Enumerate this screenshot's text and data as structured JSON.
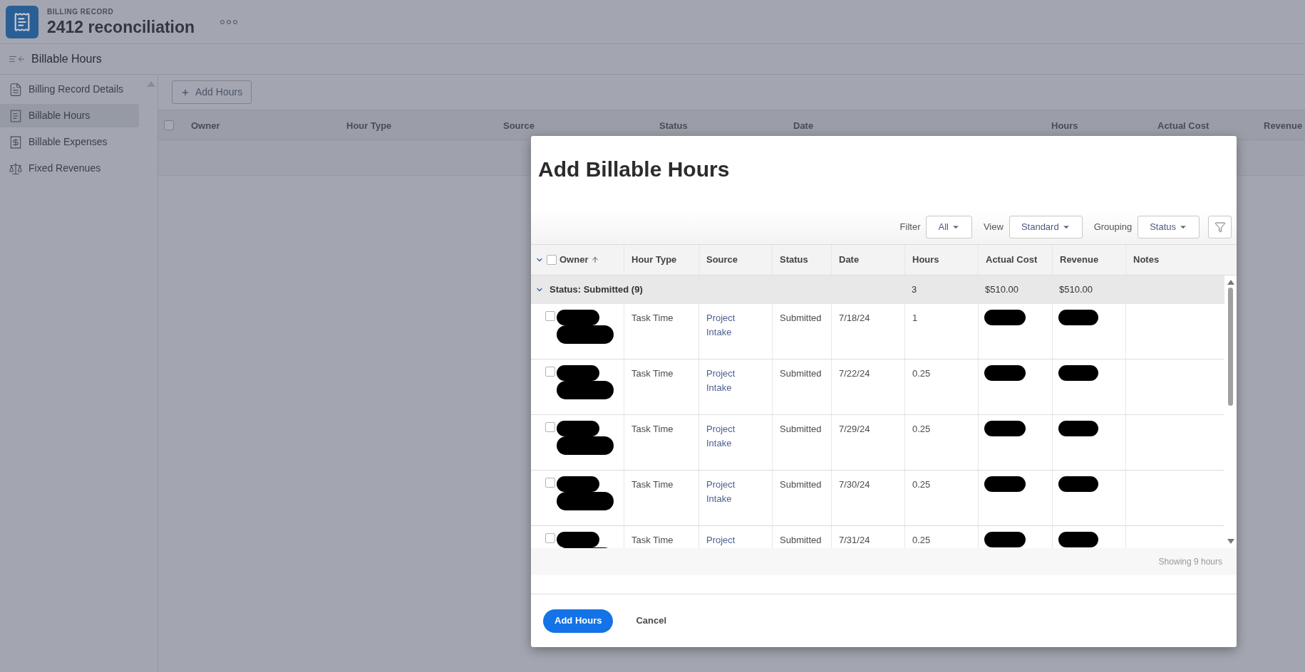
{
  "header": {
    "label": "BILLING RECORD",
    "title": "2412 reconciliation"
  },
  "nav": {
    "title": "Billable Hours"
  },
  "sidebar": {
    "items": [
      {
        "label": "Billing Record Details",
        "kind": "document",
        "selected": false
      },
      {
        "label": "Billable Hours",
        "kind": "receipt",
        "selected": true
      },
      {
        "label": "Billable Expenses",
        "kind": "expense",
        "selected": false
      },
      {
        "label": "Fixed Revenues",
        "kind": "scale",
        "selected": false
      }
    ]
  },
  "toolbar": {
    "add_button": "Add Hours"
  },
  "table": {
    "select_all_checked": false,
    "columns": [
      "Owner",
      "Hour Type",
      "Source",
      "Status",
      "Date",
      "Hours",
      "Actual Cost",
      "Revenue"
    ]
  },
  "dialog": {
    "title": "Add Billable Hours",
    "controls": [
      {
        "label": "Filter",
        "value": "All"
      },
      {
        "label": "View",
        "value": "Standard"
      },
      {
        "label": "Grouping",
        "value": "Status"
      }
    ],
    "select_all_checked": false,
    "columns": [
      {
        "label": "Owner",
        "sorted": true
      },
      {
        "label": "Hour Type",
        "sorted": false
      },
      {
        "label": "Source",
        "sorted": false
      },
      {
        "label": "Status",
        "sorted": false
      },
      {
        "label": "Date",
        "sorted": false
      },
      {
        "label": "Hours",
        "sorted": false
      },
      {
        "label": "Actual Cost",
        "sorted": false
      },
      {
        "label": "Revenue",
        "sorted": false
      },
      {
        "label": "Notes",
        "sorted": false
      }
    ],
    "group": {
      "label": "Status: Submitted (9)",
      "expanded": true,
      "hours": "3",
      "actual_cost": "$510.00",
      "revenue": "$510.00"
    },
    "rows": [
      {
        "checked": false,
        "hour_type": "Task Time",
        "source": "Project Intake",
        "status": "Submitted",
        "date": "7/18/24",
        "hours": "1"
      },
      {
        "checked": false,
        "hour_type": "Task Time",
        "source": "Project Intake",
        "status": "Submitted",
        "date": "7/22/24",
        "hours": "0.25"
      },
      {
        "checked": false,
        "hour_type": "Task Time",
        "source": "Project Intake",
        "status": "Submitted",
        "date": "7/29/24",
        "hours": "0.25"
      },
      {
        "checked": false,
        "hour_type": "Task Time",
        "source": "Project Intake",
        "status": "Submitted",
        "date": "7/30/24",
        "hours": "0.25"
      },
      {
        "checked": false,
        "hour_type": "Task Time",
        "source": "Project",
        "status": "Submitted",
        "date": "7/31/24",
        "hours": "0.25"
      }
    ],
    "footer": "Showing 9 hours",
    "buttons": [
      {
        "label": "Add Hours",
        "kind": "primary"
      },
      {
        "label": "Cancel",
        "kind": "secondary"
      }
    ]
  }
}
